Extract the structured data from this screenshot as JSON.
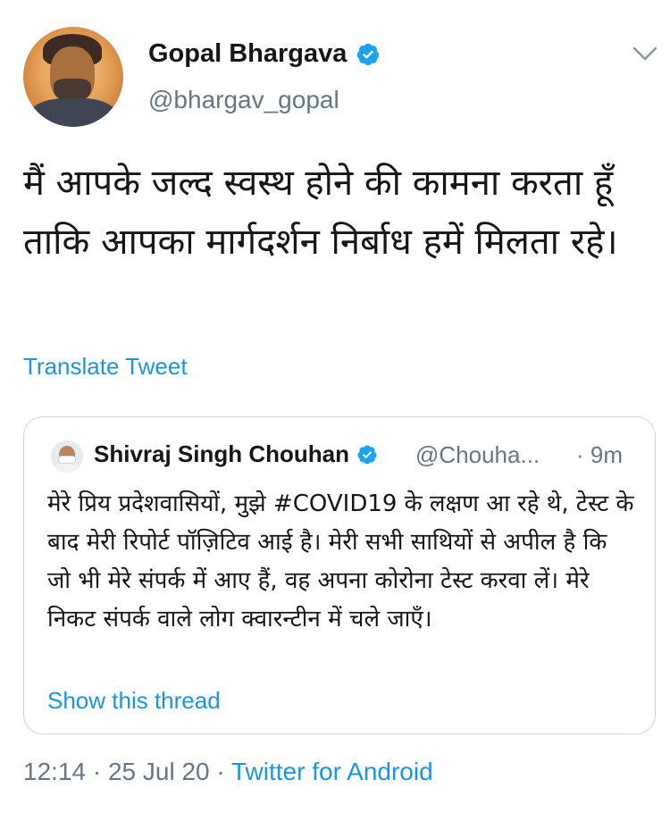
{
  "tweet": {
    "author": {
      "display_name": "Gopal Bhargava",
      "handle": "@bhargav_gopal",
      "verified": true
    },
    "text": "मैं आपके जल्द स्वस्थ होने की कामना करता हूँ ताकि आपका मार्गदर्शन निर्बाध हमें मिलता रहे।",
    "translate_label": "Translate Tweet",
    "quoted": {
      "display_name": "Shivraj Singh Chouhan",
      "handle": "@Chouha...",
      "time_sep": "·",
      "time": "9m",
      "verified": true,
      "text": "मेरे प्रिय प्रदेशवासियों, मुझे #COVID19 के लक्षण आ रहे थे, टेस्ट के बाद मेरी रिपोर्ट पॉज़िटिव आई है। मेरी सभी साथियों से अपील है कि जो भी मेरे संपर्क में आए हैं, वह अपना कोरोना टेस्ट करवा लें। मेरे निकट संपर्क वाले लोग क्वारन्टीन में चले जाएँ।",
      "show_thread_label": "Show this thread"
    },
    "meta": {
      "time": "12:14",
      "sep1": "·",
      "date": "25 Jul 20",
      "sep2": "·",
      "source": "Twitter for Android"
    }
  },
  "colors": {
    "link": "#1b95e0",
    "secondary_text": "#657786",
    "primary_text": "#14171a",
    "border": "#ccd6dd",
    "verified": "#1da1f2"
  },
  "icons": {
    "verified": "verified-badge-icon",
    "chevron": "chevron-down-icon"
  }
}
